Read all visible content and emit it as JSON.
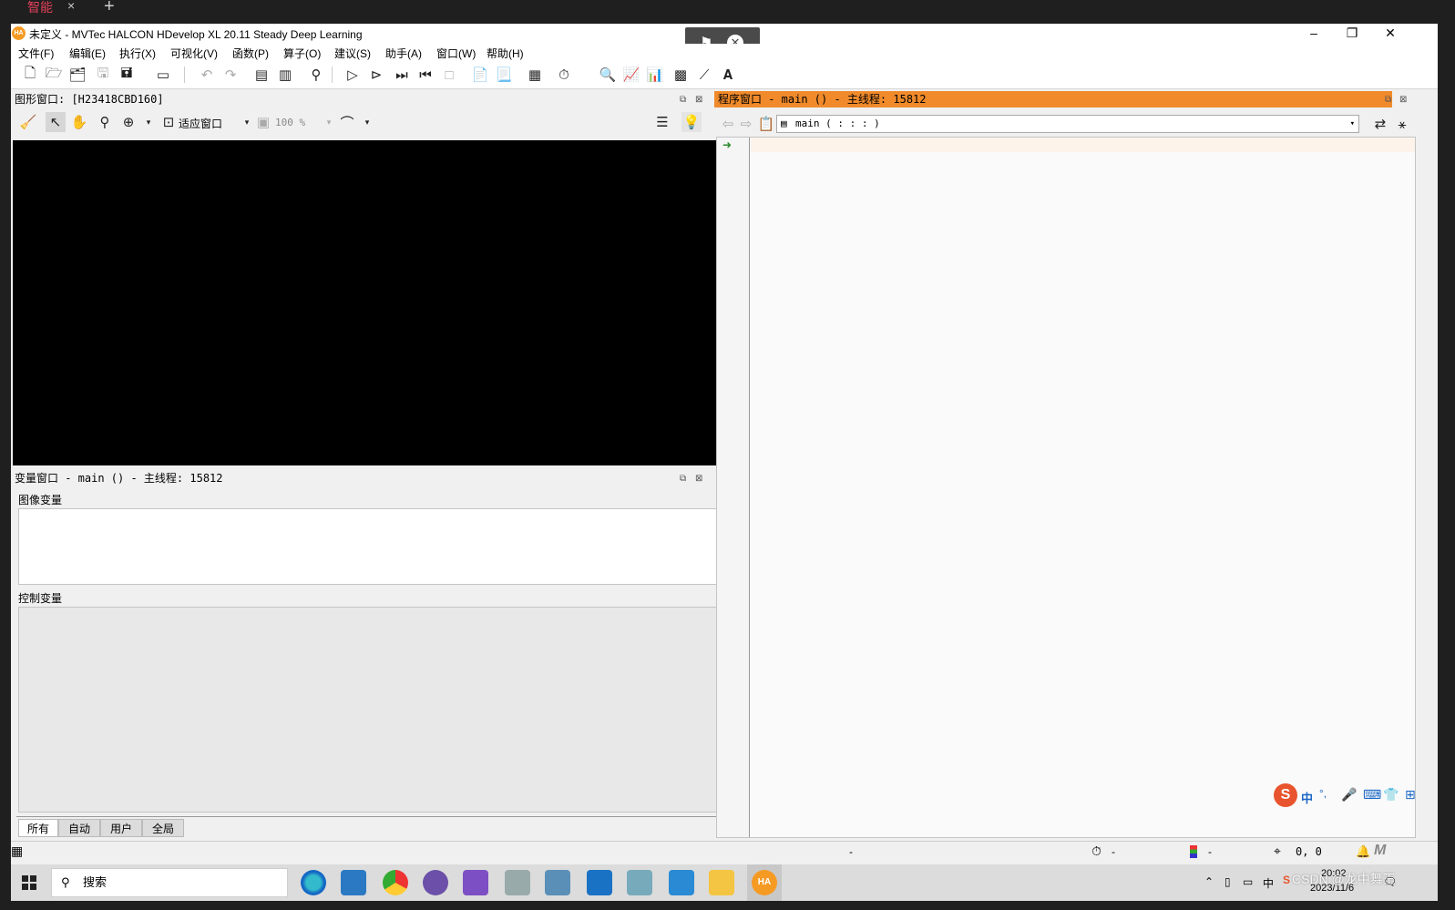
{
  "browser_tab": {
    "title": "智能",
    "close": "×",
    "new": "+"
  },
  "window": {
    "title": "未定义 - MVTec HALCON HDevelop XL 20.11 Steady Deep Learning",
    "app_icon_text": "HA",
    "minimize": "–",
    "restore": "❐",
    "close": "✕"
  },
  "overlay": {
    "flag": "⚑",
    "close": "✕"
  },
  "menu": [
    "文件(F)",
    "编辑(E)",
    "执行(X)",
    "可视化(V)",
    "函数(P)",
    "算子(O)",
    "建议(S)",
    "助手(A)",
    "窗口(W)",
    "帮助(H)"
  ],
  "graphics_window": {
    "title": "图形窗口: [H23418CBD160]",
    "fit_label": "适应窗口",
    "zoom": "100 %"
  },
  "variable_window": {
    "title": "变量窗口 - main () - 主线程: 15812",
    "image_vars": "图像变量",
    "control_vars": "控制变量",
    "tabs": [
      "所有",
      "自动",
      "用户",
      "全局"
    ]
  },
  "program_window": {
    "title": "程序窗口 - main () - 主线程: 15812",
    "procedure": "main ( : : : )"
  },
  "ime": {
    "logo": "S",
    "mode": "中",
    "punct": "°,"
  },
  "status": {
    "dash1": "-",
    "timer": "-",
    "color": "-",
    "coords": "0, 0"
  },
  "taskbar": {
    "search": "搜索",
    "lang": "中",
    "time": "20:02",
    "date": "2023/11/6",
    "watermark": "CSDN @龙中舞王"
  },
  "colors": {
    "accent": "#f08a2b",
    "tab_red": "#e0405a"
  }
}
